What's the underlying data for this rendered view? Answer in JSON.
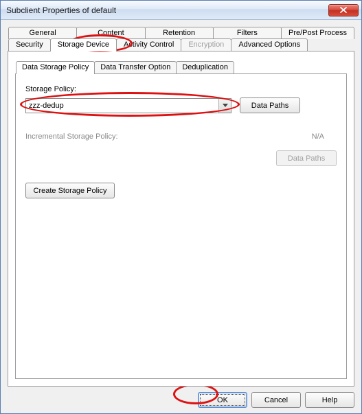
{
  "window": {
    "title": "Subclient Properties of default"
  },
  "tabs": {
    "row1": [
      "General",
      "Content",
      "Retention",
      "Filters",
      "Pre/Post Process"
    ],
    "row2": [
      "Security",
      "Storage Device",
      "Activity Control",
      "Encryption",
      "Advanced Options"
    ],
    "active": "Storage Device",
    "disabled": "Encryption"
  },
  "inner_tabs": {
    "items": [
      "Data Storage Policy",
      "Data Transfer Option",
      "Deduplication"
    ],
    "active": "Data Storage Policy"
  },
  "storage_policy": {
    "label": "Storage Policy:",
    "selected": "zzz-dedup",
    "data_paths_label": "Data Paths"
  },
  "incremental": {
    "label": "Incremental Storage Policy:",
    "value": "N/A",
    "data_paths_label": "Data Paths"
  },
  "create_btn": "Create Storage Policy",
  "footer": {
    "ok": "OK",
    "cancel": "Cancel",
    "help": "Help"
  }
}
